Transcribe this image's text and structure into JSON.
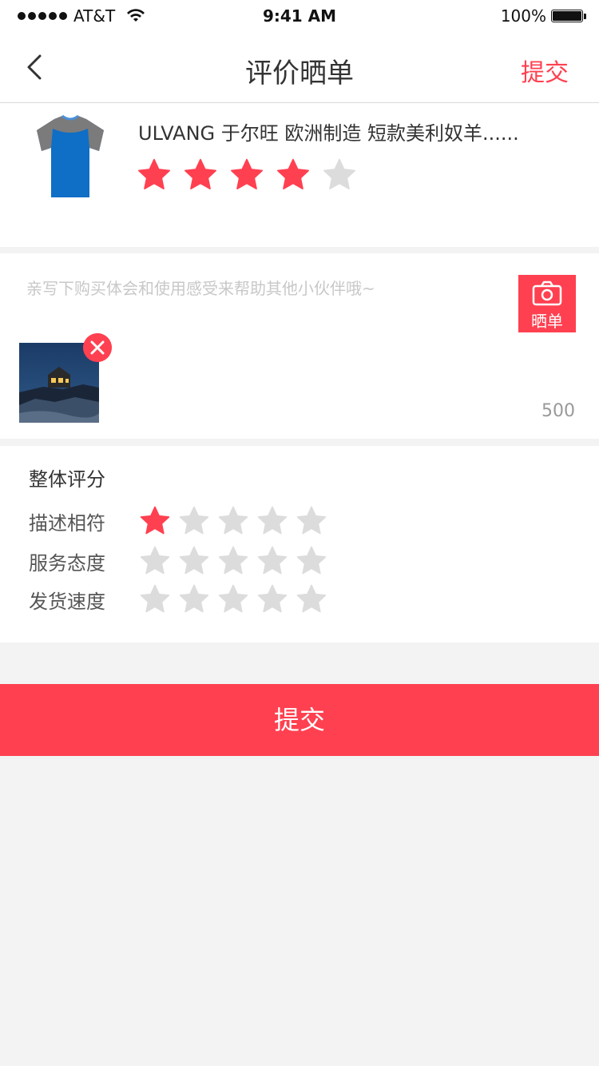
{
  "status_bar": {
    "carrier": "AT&T",
    "time": "9:41 AM",
    "battery": "100%"
  },
  "nav": {
    "title": "评价晒单",
    "submit": "提交",
    "back_icon": "chevron-left-icon"
  },
  "product": {
    "name": "ULVANG 于尔旺 欧洲制造 短款美利奴羊......",
    "rating": 4,
    "max_rating": 5
  },
  "review": {
    "placeholder": "亲写下购买体会和使用感受来帮助其他小伙伴哦~",
    "photo_button": "晒单",
    "char_count": "500"
  },
  "ratings": {
    "title": "整体评分",
    "rows": [
      {
        "label": "描述相符",
        "value": 1
      },
      {
        "label": "服务态度",
        "value": 0
      },
      {
        "label": "发货速度",
        "value": 0
      }
    ]
  },
  "submit_button": "提交",
  "colors": {
    "accent": "#ff4050",
    "star_off": "#dcdcdc"
  }
}
